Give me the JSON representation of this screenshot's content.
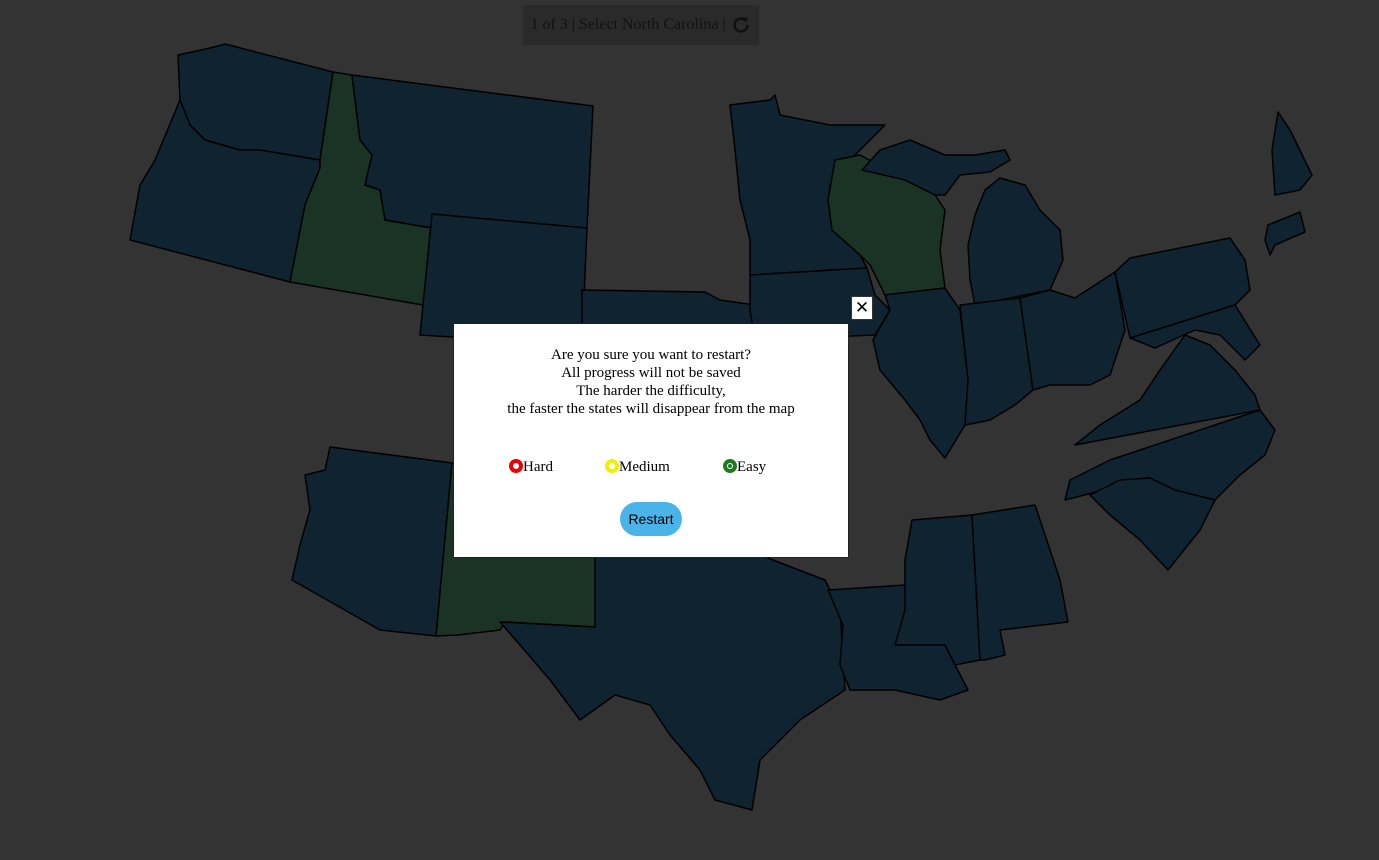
{
  "status": {
    "progress": "1 of 3",
    "separator": "|",
    "prompt": "Select North Carolina",
    "refresh_icon": "refresh-icon"
  },
  "modal": {
    "lines": [
      "Are you sure you want to restart?",
      "All progress will not be saved",
      "The harder the difficulty,",
      "the faster the states will disappear from the map"
    ],
    "difficulties": [
      {
        "label": "Hard",
        "color": "#ee0000",
        "selected": false
      },
      {
        "label": "Medium",
        "color": "#f0f000",
        "selected": false
      },
      {
        "label": "Easy",
        "color": "#1f7a1f",
        "selected": true
      }
    ],
    "restart_label": "Restart",
    "close_glyph": "✕"
  },
  "map": {
    "state_fill": "#0f2330",
    "found_fill": "#1b3325",
    "background": "#333333",
    "found_states": [
      "Idaho",
      "Wisconsin",
      "New Mexico"
    ]
  }
}
